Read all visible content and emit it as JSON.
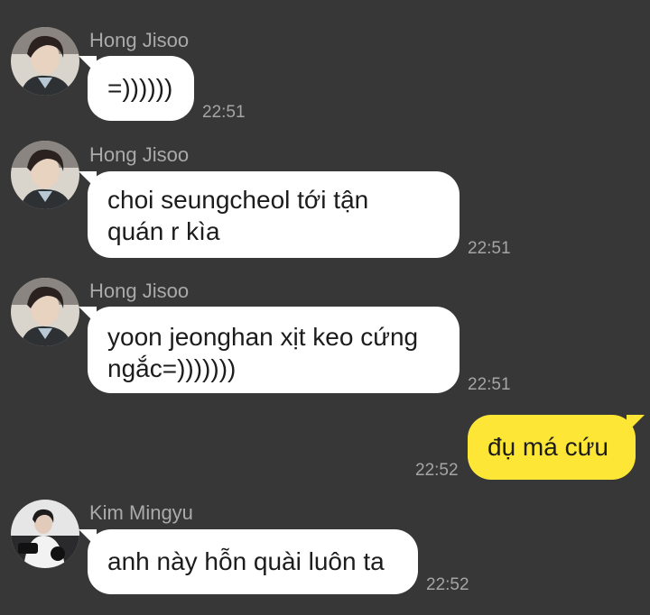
{
  "colors": {
    "background": "#363736",
    "incoming_bubble": "#ffffff",
    "outgoing_bubble": "#fde636",
    "sender_text": "#a9aaa9",
    "time_text": "#a4a5a4"
  },
  "messages": [
    {
      "sender": "Hong Jisoo",
      "avatar": "hong-jisoo-avatar",
      "text": "=))))))",
      "time": "22:51",
      "direction": "incoming"
    },
    {
      "sender": "Hong Jisoo",
      "avatar": "hong-jisoo-avatar",
      "text": "choi seungcheol tới tận\nquán r kìa",
      "time": "22:51",
      "direction": "incoming"
    },
    {
      "sender": "Hong Jisoo",
      "avatar": "hong-jisoo-avatar",
      "text": "yoon jeonghan xịt keo cứng\nngắc=)))))))",
      "time": "22:51",
      "direction": "incoming"
    },
    {
      "text": "đụ má cứu",
      "time": "22:52",
      "direction": "outgoing"
    },
    {
      "sender": "Kim Mingyu",
      "avatar": "kim-mingyu-avatar",
      "text": "anh này hỗn quài luôn ta",
      "time": "22:52",
      "direction": "incoming"
    }
  ]
}
